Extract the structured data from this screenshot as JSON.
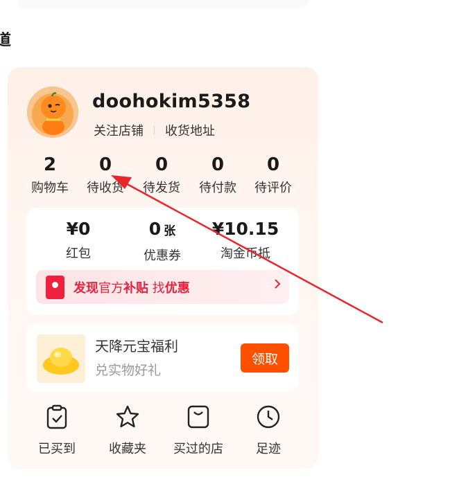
{
  "left_heading": "道",
  "profile": {
    "username": "doohokim5358",
    "links": [
      "关注店铺",
      "收货地址"
    ]
  },
  "order_stats": [
    {
      "value": "2",
      "label": "购物车"
    },
    {
      "value": "0",
      "label": "待收货"
    },
    {
      "value": "0",
      "label": "待发货"
    },
    {
      "value": "0",
      "label": "待付款"
    },
    {
      "value": "0",
      "label": "待评价"
    }
  ],
  "assets": [
    {
      "value": "¥0",
      "unit": "",
      "label": "红包"
    },
    {
      "value": "0",
      "unit": "张",
      "label": "优惠券"
    },
    {
      "value": "¥10.15",
      "unit": "",
      "label": "淘金币抵"
    }
  ],
  "promo": {
    "part1_strong": "发现",
    "part2": "官方",
    "part3_strong": "补贴",
    "part4": " 找",
    "part5_strong": "优惠"
  },
  "reward": {
    "title": "天降元宝福利",
    "subtitle": "兑实物好礼",
    "button": "领取"
  },
  "quick_links": [
    {
      "label": "已买到",
      "icon": "clipboard-check-icon"
    },
    {
      "label": "收藏夹",
      "icon": "star-icon"
    },
    {
      "label": "买过的店",
      "icon": "shop-bag-icon"
    },
    {
      "label": "足迹",
      "icon": "clock-icon"
    }
  ],
  "colors": {
    "accent": "#ff5000",
    "promo_red": "#e8213d",
    "annotation_arrow": "#e8262a"
  }
}
